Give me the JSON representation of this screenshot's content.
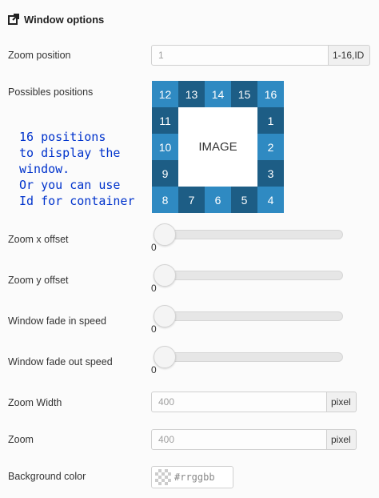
{
  "header": {
    "title": "Window options",
    "icon": "external-link-icon"
  },
  "zoom_position": {
    "label": "Zoom position",
    "value": "1",
    "addon": "1-16,ID"
  },
  "positions": {
    "label": "Possibles positions",
    "image_label": "IMAGE",
    "note_lines": [
      "16 positions",
      "to display the",
      "window.",
      "Or you can use",
      "Id for container"
    ],
    "cells": {
      "top": [
        "12",
        "13",
        "14",
        "15",
        "16"
      ],
      "left": [
        "11",
        "10",
        "9"
      ],
      "right": [
        "1",
        "2",
        "3"
      ],
      "bottom": [
        "8",
        "7",
        "6",
        "5",
        "4"
      ]
    },
    "colors": {
      "light": "#2f8ac2",
      "dark": "#1d5d85"
    }
  },
  "sliders": [
    {
      "label": "Zoom x offset",
      "value": "0"
    },
    {
      "label": "Zoom y offset",
      "value": "0"
    },
    {
      "label": "Window fade in speed",
      "value": "0"
    },
    {
      "label": "Window fade out speed",
      "value": "0"
    }
  ],
  "zoom_width": {
    "label": "Zoom Width",
    "placeholder": "400",
    "addon": "pixel"
  },
  "zoom": {
    "label": "Zoom",
    "placeholder": "400",
    "addon": "pixel"
  },
  "background_color": {
    "label": "Background color",
    "placeholder": "#rrggbb"
  }
}
